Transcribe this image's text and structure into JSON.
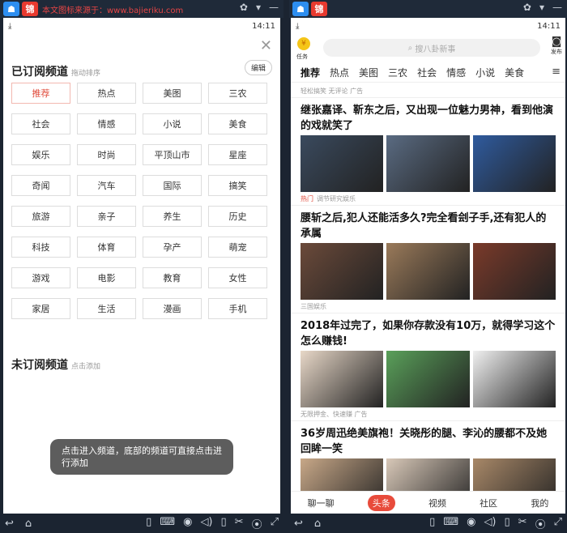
{
  "left": {
    "titlebar": {
      "icon1": "☗",
      "icon2": "锦",
      "watermark": "本文图标来源于：www.bajieriku.com",
      "icons": [
        "◐",
        "✿",
        "▾",
        "—",
        "▢",
        "✕"
      ]
    },
    "statusbar": {
      "time": "14:11"
    },
    "close": "✕",
    "subscribed": {
      "title": "已订阅频道",
      "sub": "拖动排序",
      "edit": "编辑"
    },
    "channels": [
      "推荐",
      "热点",
      "美图",
      "三农",
      "社会",
      "情感",
      "小说",
      "美食",
      "娱乐",
      "时尚",
      "平顶山市",
      "星座",
      "奇闻",
      "汽车",
      "国际",
      "搞笑",
      "旅游",
      "亲子",
      "养生",
      "历史",
      "科技",
      "体育",
      "孕产",
      "萌宠",
      "游戏",
      "电影",
      "教育",
      "女性",
      "家居",
      "生活",
      "漫画",
      "手机"
    ],
    "active_channel": 0,
    "unsubscribed": {
      "title": "未订阅频道",
      "sub": "点击添加"
    },
    "toast": "点击进入频道，底部的频道可直接点击进行添加",
    "navbar": {
      "back": "↩",
      "home": "⌂",
      "icons": [
        "▯",
        "⌨",
        "◉",
        "◁)",
        "▯",
        "✂",
        "⦿",
        "⤢"
      ]
    }
  },
  "right": {
    "titlebar": {
      "icon1": "☗",
      "icon2": "锦",
      "icons": [
        "◐",
        "✿",
        "▾",
        "—",
        "▢",
        "✕"
      ]
    },
    "statusbar": {
      "time": "14:11"
    },
    "coin_label": "任务",
    "search_placeholder": "搜八卦新事",
    "camera_label": "发布",
    "tabs": [
      "推荐",
      "热点",
      "美图",
      "三农",
      "社会",
      "情感",
      "小说",
      "美食"
    ],
    "active_tab": 0,
    "feed": {
      "top_meta": "轻松搞笑  无评论  广告",
      "articles": [
        {
          "headline": "继张嘉译、靳东之后，又出现一位魅力男神，看到他演的戏就笑了",
          "tag": "热门",
          "meta": "调节研究娱乐"
        },
        {
          "headline": "腰斩之后,犯人还能活多久?完全看刽子手,还有犯人的承属",
          "tag": "",
          "meta": "三国娱乐"
        },
        {
          "headline": "2018年过完了，如果你存款没有10万，就得学习这个怎么赚钱!",
          "tag": "",
          "meta": "无限押金、快速赚  广告"
        },
        {
          "headline": "36岁周迅绝美旗袍！关晓彤的腿、李沁的腰都不及她回眸一笑",
          "tag": "",
          "meta": ""
        }
      ]
    },
    "bottombar": [
      "聊一聊",
      "头条",
      "视频",
      "社区",
      "我的"
    ],
    "active_bottom": 1,
    "navbar": {
      "back": "↩",
      "home": "⌂",
      "icons": [
        "▯",
        "⌨",
        "◉",
        "◁)",
        "▯",
        "✂",
        "⦿",
        "⤢"
      ]
    }
  }
}
